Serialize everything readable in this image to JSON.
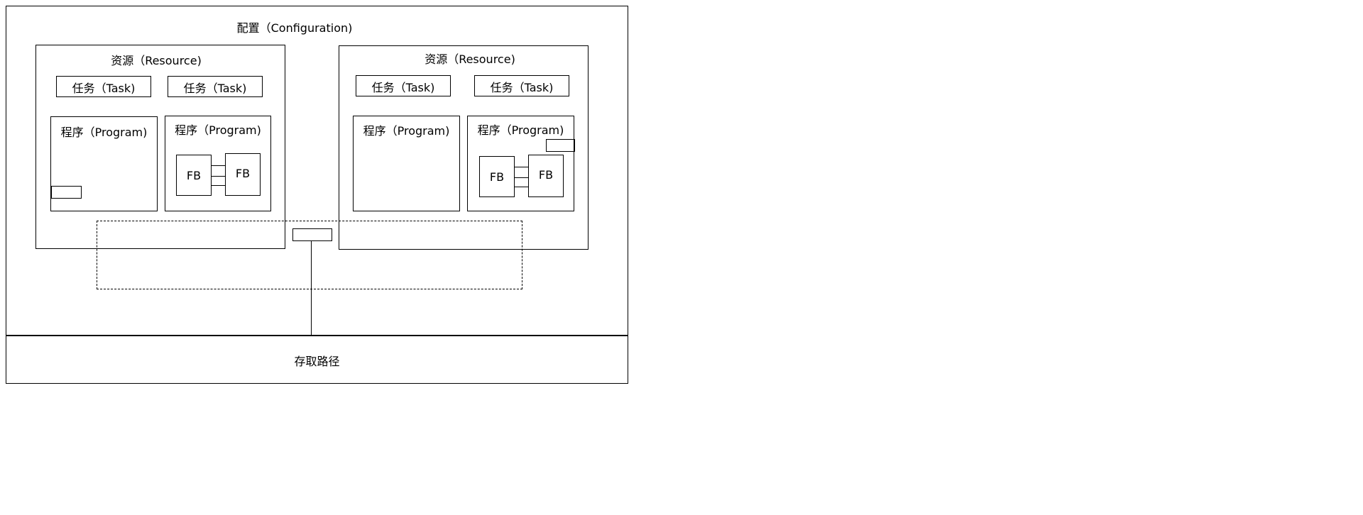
{
  "diagram": {
    "configuration_title": "配置（Configuration)",
    "access_path_label": "存取路径",
    "resources": [
      {
        "title": "资源（Resource)",
        "tasks": [
          "任务（Task)",
          "任务（Task)"
        ],
        "programs": [
          {
            "title": "程序（Program)"
          },
          {
            "title": "程序（Program)",
            "fbs": [
              "FB",
              "FB"
            ]
          }
        ]
      },
      {
        "title": "资源（Resource)",
        "tasks": [
          "任务（Task)",
          "任务（Task)"
        ],
        "programs": [
          {
            "title": "程序（Program)"
          },
          {
            "title": "程序（Program)",
            "fbs": [
              "FB",
              "FB"
            ]
          }
        ]
      }
    ]
  }
}
